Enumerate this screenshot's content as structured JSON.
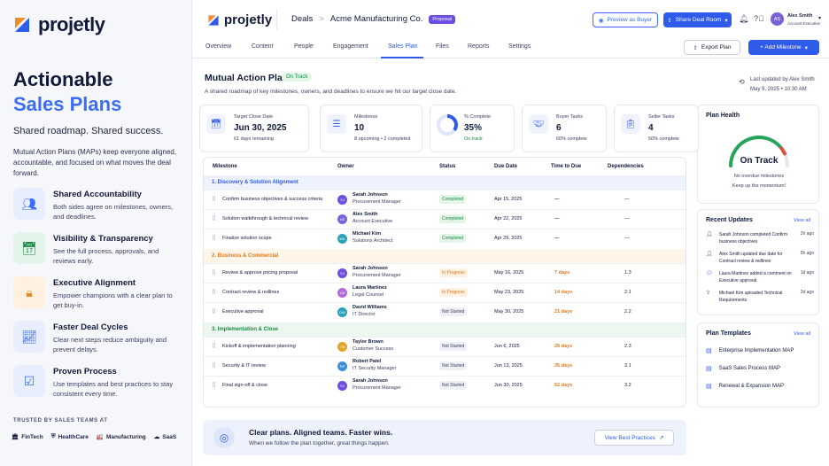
{
  "brand": {
    "name": "projetly"
  },
  "hero": {
    "line1": "Actionable",
    "line2": "Sales Plans",
    "tagline": "Shared roadmap. Shared success.",
    "intro": "Mutual Action Plans (MAPs) keep everyone aligned, accountable, and focused on what moves the deal forward."
  },
  "features": [
    {
      "title": "Shared Accountability",
      "desc": "Both sides agree on milestones, owners, and deadlines.",
      "icon": "users-icon",
      "bg": "#e8eefd",
      "color": "#3b6cf6"
    },
    {
      "title": "Visibility & Transparency",
      "desc": "See the full process, approvals, and reviews early.",
      "icon": "calendar-check-icon",
      "bg": "#e3f5ea",
      "color": "#1b8a43"
    },
    {
      "title": "Executive Alignment",
      "desc": "Empower champions with a clear plan to get buy-in.",
      "icon": "lock-icon",
      "bg": "#fff0e0",
      "color": "#e08a2a"
    },
    {
      "title": "Faster Deal Cycles",
      "desc": "Clear next steps reduce ambiguity and prevent delays.",
      "icon": "trend-up-icon",
      "bg": "#e8eefd",
      "color": "#3b6cf6"
    },
    {
      "title": "Proven Process",
      "desc": "Use templates and best practices to stay consistent every time.",
      "icon": "checklist-icon",
      "bg": "#e8eefd",
      "color": "#3b6cf6"
    }
  ],
  "trusted": {
    "label": "TRUSTED BY SALES TEAMS AT",
    "industries": [
      "FinTech",
      "HealthCare",
      "Manufacturing",
      "SaaS"
    ]
  },
  "header": {
    "deals": "Deals",
    "sep": ">",
    "account": "Acme Manufacturing Co.",
    "stage": "Proposal",
    "preview": "Preview as Buyer",
    "share": "Share Deal Room",
    "user_initials": "AS",
    "user_name": "Alex Smith",
    "user_role": "Account Executive"
  },
  "tabs": [
    "Overview",
    "Content",
    "People",
    "Engagement",
    "Sales Plan",
    "Files",
    "Reports",
    "Settings"
  ],
  "active_tab": "Sales Plan",
  "actions": {
    "export": "Export Plan",
    "add": "+ Add Milestone"
  },
  "plan": {
    "title": "Mutual Action Plan",
    "status": "On Track",
    "subtitle": "A shared roadmap of key milestones, owners, and deadlines to ensure we hit our target close date.",
    "updated_by": "Last updated by Alex Smith",
    "updated_at": "May 9, 2025     •     10:30 AM"
  },
  "stats": [
    {
      "label": "Target Close Date",
      "value": "Jun 30, 2025",
      "sub": "61 days remaining",
      "icon": "calendar-icon"
    },
    {
      "label": "Milestones",
      "value": "10",
      "sub": "8 upcoming  •  2 completed",
      "icon": "list-icon"
    },
    {
      "label": "% Complete",
      "value": "35%",
      "sub": "On track",
      "icon": "progress-ring-icon",
      "progress": 0.35
    },
    {
      "label": "Buyer Tasks",
      "value": "6",
      "sub": "60% complete",
      "icon": "handshake-icon"
    },
    {
      "label": "Seller Tasks",
      "value": "4",
      "sub": "50% complete",
      "icon": "clipboard-icon"
    }
  ],
  "table": {
    "headers": [
      "Milestone",
      "Owner",
      "Status",
      "Due Date",
      "Time to Due",
      "Dependencies"
    ],
    "groups": [
      {
        "name": "1. Discovery & Solution Alignment",
        "color": "#2f5bea",
        "bg": "#eef2fd",
        "rows": [
          {
            "milestone": "Confirm business objectives & success criteria",
            "owner": "Sarah Johnson",
            "role": "Procurement Manager",
            "initials": "SJ",
            "avatar": "#6c4ee0",
            "status": "Completed",
            "due": "Apr 15, 2025",
            "ttd": "—",
            "dep": "—"
          },
          {
            "milestone": "Solution walkthrough & technical review",
            "owner": "Alex Smith",
            "role": "Account Executive",
            "initials": "AS",
            "avatar": "#7b61d9",
            "status": "Completed",
            "due": "Apr 22, 2025",
            "ttd": "—",
            "dep": "—"
          },
          {
            "milestone": "Finalize solution scope",
            "owner": "Michael Kim",
            "role": "Solutions Architect",
            "initials": "MK",
            "avatar": "#2aa1b8",
            "status": "Completed",
            "due": "Apr 29, 2025",
            "ttd": "—",
            "dep": "—"
          }
        ]
      },
      {
        "name": "2. Business & Commercial",
        "color": "#e07a1f",
        "bg": "#fff4e8",
        "rows": [
          {
            "milestone": "Review & approve pricing proposal",
            "owner": "Sarah Johnson",
            "role": "Procurement Manager",
            "initials": "SJ",
            "avatar": "#6c4ee0",
            "status": "In Progress",
            "due": "May 16, 2025",
            "ttd": "7 days",
            "dep": "1.3"
          },
          {
            "milestone": "Contract review & redlines",
            "owner": "Laura Martinez",
            "role": "Legal Counsel",
            "initials": "LM",
            "avatar": "#b56ad9",
            "status": "In Progress",
            "due": "May 23, 2025",
            "ttd": "14 days",
            "dep": "2.1"
          },
          {
            "milestone": "Executive approval",
            "owner": "David Williams",
            "role": "IT Director",
            "initials": "DW",
            "avatar": "#2aa1b8",
            "status": "Not Started",
            "due": "May 30, 2025",
            "ttd": "21 days",
            "dep": "2.2"
          }
        ]
      },
      {
        "name": "3. Implementation & Close",
        "color": "#1b8a43",
        "bg": "#ebf7ef",
        "rows": [
          {
            "milestone": "Kickoff & implementation planning",
            "owner": "Taylor Brown",
            "role": "Customer Success",
            "initials": "TB",
            "avatar": "#e0a52a",
            "status": "Not Started",
            "due": "Jun 6, 2025",
            "ttd": "28 days",
            "dep": "2.3"
          },
          {
            "milestone": "Security & IT review",
            "owner": "Robert Patel",
            "role": "IT Security Manager",
            "initials": "RP",
            "avatar": "#3b8fd9",
            "status": "Not Started",
            "due": "Jun 13, 2025",
            "ttd": "35 days",
            "dep": "3.1"
          },
          {
            "milestone": "Final sign-off & close",
            "owner": "Sarah Johnson",
            "role": "Procurement Manager",
            "initials": "SJ",
            "avatar": "#6c4ee0",
            "status": "Not Started",
            "due": "Jun 30, 2025",
            "ttd": "52 days",
            "dep": "3.2"
          }
        ]
      }
    ]
  },
  "banner": {
    "title": "Clear plans. Aligned teams. Faster wins.",
    "sub": "When we follow the plan together, great things happen.",
    "button": "View Best Practices"
  },
  "health": {
    "title": "Plan Health",
    "status": "On Track",
    "note1": "No overdue milestones",
    "note2": "Keep up the momentum!",
    "score": 0.78
  },
  "updates": {
    "title": "Recent Updates",
    "view_all": "View all",
    "items": [
      {
        "text": "Sarah Johnson completed Confirm business objectives",
        "time": "2h ago"
      },
      {
        "text": "Alex Smith updated due date for Contract review & redlines",
        "time": "5h ago"
      },
      {
        "text": "Laura Martinez added a comment on Executive approval",
        "time": "1d ago"
      },
      {
        "text": "Michael Kim uploaded Technical Requirements",
        "time": "2d ago"
      }
    ]
  },
  "templates": {
    "title": "Plan Templates",
    "view_all": "View all",
    "items": [
      "Enterprise Implementation MAP",
      "SaaS Sales Process MAP",
      "Renewal & Expansion MAP"
    ]
  }
}
